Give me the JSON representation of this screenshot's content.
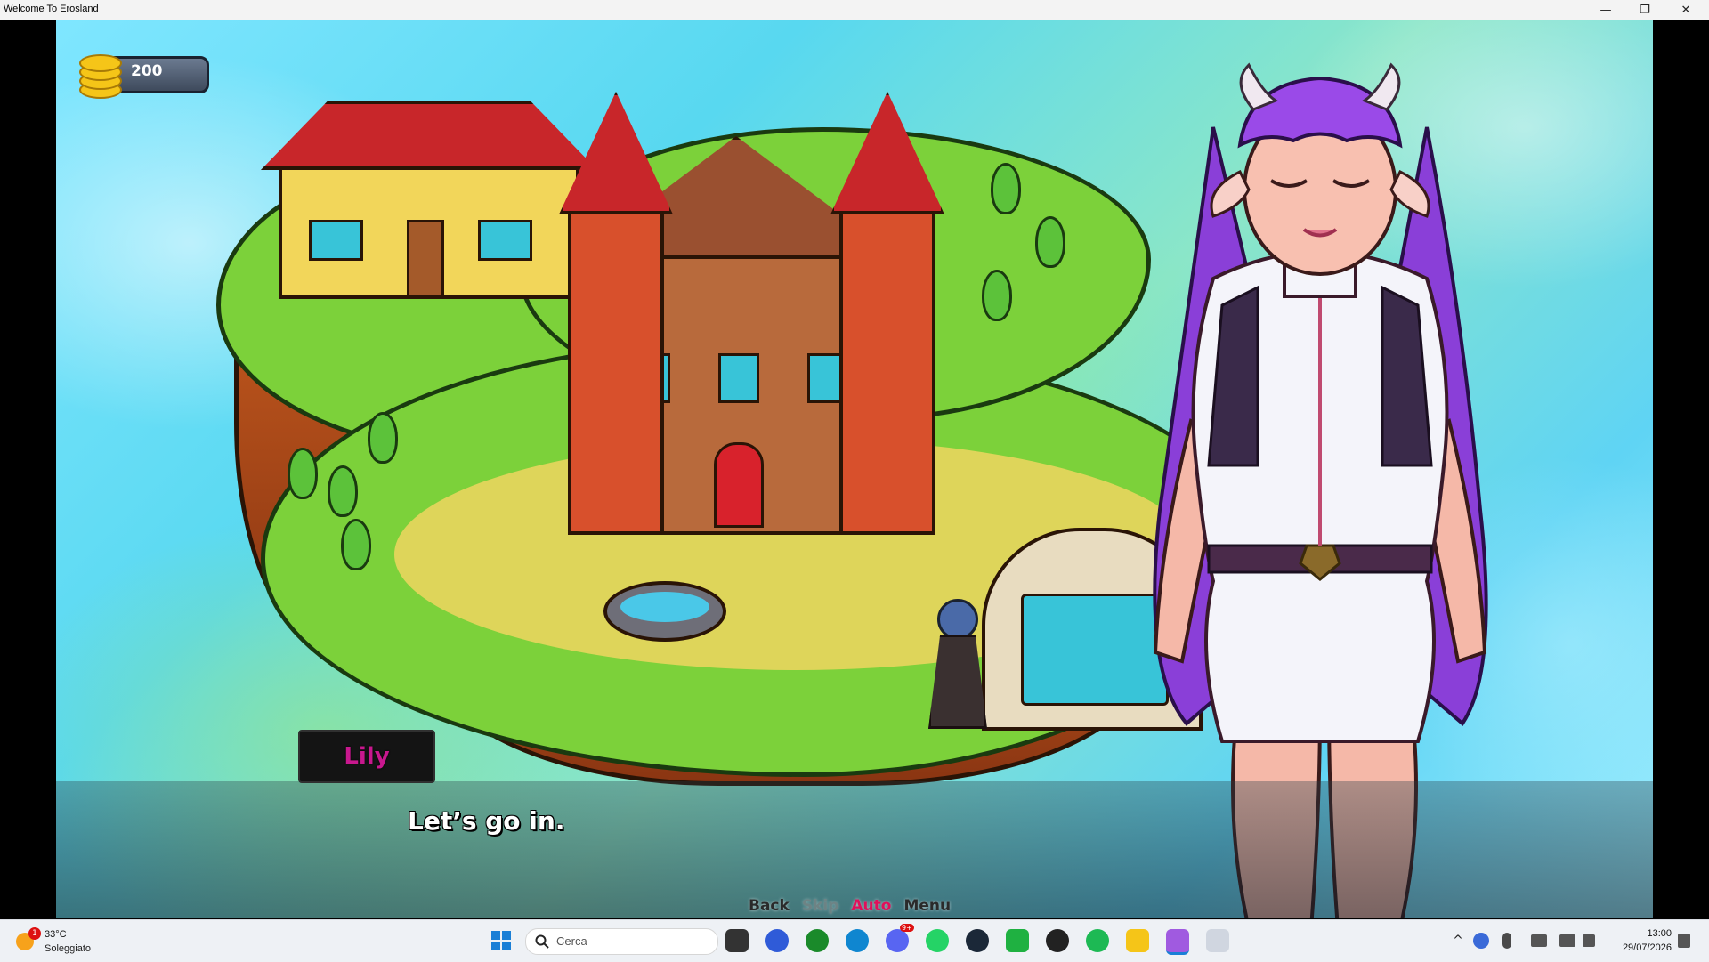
{
  "window": {
    "title": "Welcome To Erosland",
    "minimize_glyph": "—",
    "restore_glyph": "❐",
    "close_glyph": "✕"
  },
  "hud": {
    "coins": "200"
  },
  "dialogue": {
    "speaker": "Lily",
    "text": "Let’s go in.",
    "speaker_color": "#c8188e"
  },
  "quick_menu": {
    "back": "Back",
    "skip": "Skip",
    "auto": "Auto",
    "menu": "Menu",
    "auto_color": "#e0105a"
  },
  "taskbar": {
    "weather_badge": "1",
    "temperature": "33°C",
    "weather_desc": "Soleggiato",
    "search_placeholder": "Cerca",
    "time": "13:00",
    "date": "29/07/2026",
    "chat_badge": "9+"
  }
}
